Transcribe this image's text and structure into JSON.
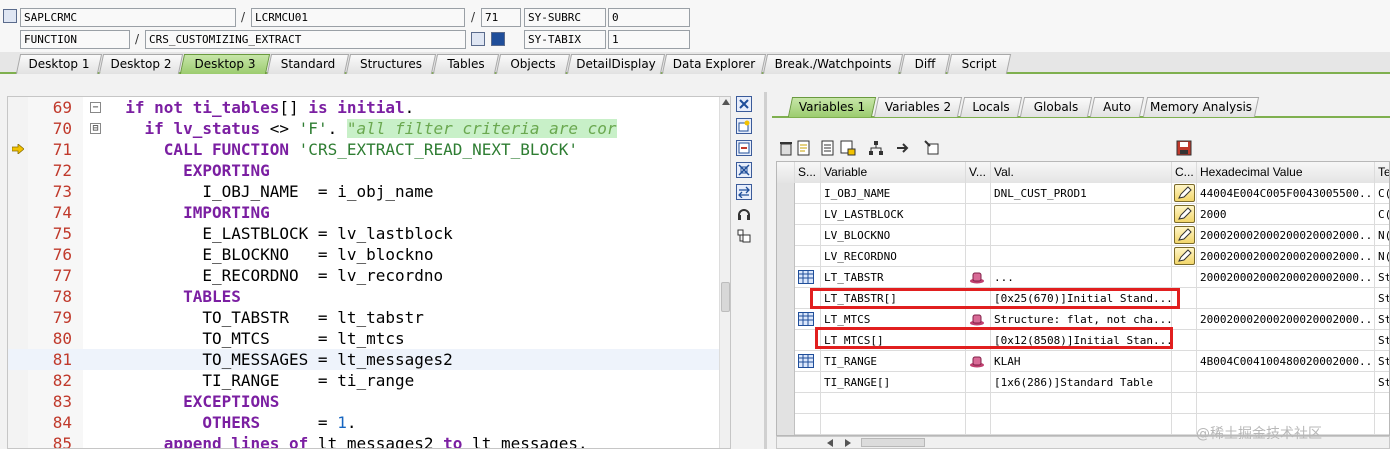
{
  "header": {
    "program": "SAPLCRMC",
    "include": "LCRMCU01",
    "line": "71",
    "sy_subrc_label": "SY-SUBRC",
    "sy_subrc_value": "0",
    "event_type": "FUNCTION",
    "event_name": "CRS_CUSTOMIZING_EXTRACT",
    "sy_tabix_label": "SY-TABIX",
    "sy_tabix_value": "1"
  },
  "tabs": [
    "Desktop 1",
    "Desktop 2",
    "Desktop 3",
    "Standard",
    "Structures",
    "Tables",
    "Objects",
    "DetailDisplay",
    "Data Explorer",
    "Break./Watchpoints",
    "Diff",
    "Script"
  ],
  "active_tab": "Desktop 3",
  "code": [
    {
      "n": "69",
      "fold": "−",
      "parts": [
        [
          "",
          "  "
        ],
        [
          "kw",
          "if not"
        ],
        [
          "",
          " "
        ],
        [
          "kw",
          "ti_tables"
        ],
        [
          "",
          "[] "
        ],
        [
          "kw",
          "is initial"
        ],
        [
          "",
          "."
        ]
      ]
    },
    {
      "n": "70",
      "fold": "⊟",
      "parts": [
        [
          "",
          "    "
        ],
        [
          "kw",
          "if"
        ],
        [
          "",
          " "
        ],
        [
          "kw",
          "lv_status"
        ],
        [
          "",
          " <> "
        ],
        [
          "str",
          "'F'"
        ],
        [
          "",
          ". "
        ],
        [
          "cmt",
          "\"all filter criteria are cor"
        ]
      ]
    },
    {
      "n": "71",
      "fold": "",
      "parts": [
        [
          "",
          "      "
        ],
        [
          "kw",
          "CALL FUNCTION"
        ],
        [
          "",
          " "
        ],
        [
          "str",
          "'CRS_EXTRACT_READ_NEXT_BLOCK'"
        ]
      ]
    },
    {
      "n": "72",
      "fold": "",
      "parts": [
        [
          "",
          "        "
        ],
        [
          "kw",
          "EXPORTING"
        ]
      ]
    },
    {
      "n": "73",
      "fold": "",
      "parts": [
        [
          "",
          "          I_OBJ_NAME  = i_obj_name"
        ]
      ]
    },
    {
      "n": "74",
      "fold": "",
      "parts": [
        [
          "",
          "        "
        ],
        [
          "kw",
          "IMPORTING"
        ]
      ]
    },
    {
      "n": "75",
      "fold": "",
      "parts": [
        [
          "",
          "          E_LASTBLOCK = lv_lastblock"
        ]
      ]
    },
    {
      "n": "76",
      "fold": "",
      "parts": [
        [
          "",
          "          E_BLOCKNO   = lv_blockno"
        ]
      ]
    },
    {
      "n": "77",
      "fold": "",
      "parts": [
        [
          "",
          "          E_RECORDNO  = lv_recordno"
        ]
      ]
    },
    {
      "n": "78",
      "fold": "",
      "parts": [
        [
          "",
          "        "
        ],
        [
          "kw",
          "TABLES"
        ]
      ]
    },
    {
      "n": "79",
      "fold": "",
      "parts": [
        [
          "",
          "          TO_TABSTR   = lt_tabstr"
        ]
      ]
    },
    {
      "n": "80",
      "fold": "",
      "parts": [
        [
          "",
          "          TO_MTCS     = lt_mtcs"
        ]
      ]
    },
    {
      "n": "81",
      "fold": "",
      "parts": [
        [
          "",
          "          TO_MESSAGES = lt_messages2"
        ]
      ]
    },
    {
      "n": "82",
      "fold": "",
      "parts": [
        [
          "",
          "          TI_RANGE    = ti_range"
        ]
      ]
    },
    {
      "n": "83",
      "fold": "",
      "parts": [
        [
          "",
          "        "
        ],
        [
          "kw",
          "EXCEPTIONS"
        ]
      ]
    },
    {
      "n": "84",
      "fold": "",
      "parts": [
        [
          "",
          "          "
        ],
        [
          "kw",
          "OTHERS"
        ],
        [
          "",
          "      = "
        ],
        [
          "num",
          "1"
        ],
        [
          "",
          "."
        ]
      ]
    },
    {
      "n": "85",
      "fold": "",
      "parts": [
        [
          "",
          "      "
        ],
        [
          "kw",
          "append lines of"
        ],
        [
          "",
          " lt_messages2 "
        ],
        [
          "kw",
          "to"
        ],
        [
          "",
          " lt_messages."
        ]
      ]
    }
  ],
  "subtabs": [
    "Variables 1",
    "Variables 2",
    "Locals",
    "Globals",
    "Auto",
    "Memory Analysis"
  ],
  "active_subtab": "Variables 1",
  "grid": {
    "headers": [
      "S...",
      "Variable",
      "V...",
      "Val.",
      "C...",
      "Hexadecimal Value",
      "Te"
    ],
    "rows": [
      {
        "icon": "",
        "var": "I_OBJ_NAME",
        "vicon": "",
        "val": "DNL_CUST_PROD1",
        "edit": true,
        "hex": "44004E004C005F0043005500...",
        "te": "C("
      },
      {
        "icon": "",
        "var": "LV_LASTBLOCK",
        "vicon": "",
        "val": "",
        "edit": true,
        "hex": "2000",
        "te": "C("
      },
      {
        "icon": "",
        "var": "LV_BLOCKNO",
        "vicon": "",
        "val": "",
        "edit": true,
        "hex": "200020002000200020002000...",
        "te": "N("
      },
      {
        "icon": "",
        "var": "LV_RECORDNO",
        "vicon": "",
        "val": "",
        "edit": true,
        "hex": "200020002000200020002000...",
        "te": "N("
      },
      {
        "icon": "table",
        "var": "LT_TABSTR",
        "vicon": "hat",
        "val": "...",
        "edit": false,
        "hex": "200020002000200020002000...",
        "te": "St"
      },
      {
        "icon": "",
        "var": "LT_TABSTR[]",
        "vicon": "",
        "val": "[0x25(670)]Initial Stand...",
        "edit": false,
        "hex": "",
        "te": "St"
      },
      {
        "icon": "table",
        "var": "LT_MTCS",
        "vicon": "hat",
        "val": "Structure: flat, not cha...",
        "edit": false,
        "hex": "200020002000200020002000...",
        "te": "St"
      },
      {
        "icon": "",
        "var": "LT_MTCS[]",
        "vicon": "",
        "val": "[0x12(8508)]Initial Stan...",
        "edit": false,
        "hex": "",
        "te": "St"
      },
      {
        "icon": "table",
        "var": "TI_RANGE",
        "vicon": "hat",
        "val": "KLAH",
        "edit": false,
        "hex": "4B004C004100480020002000...",
        "te": "St"
      },
      {
        "icon": "",
        "var": "TI_RANGE[]",
        "vicon": "",
        "val": "[1x6(286)]Standard Table",
        "edit": false,
        "hex": "",
        "te": "St"
      }
    ]
  },
  "watermark": "@稀土掘金技术社区",
  "colors": {
    "tab_active": "#9ccc6f",
    "highlight_box": "#e11f1f",
    "keyword": "#7b1fa2",
    "string": "#2e7d32",
    "line_number": "#c0392b"
  }
}
